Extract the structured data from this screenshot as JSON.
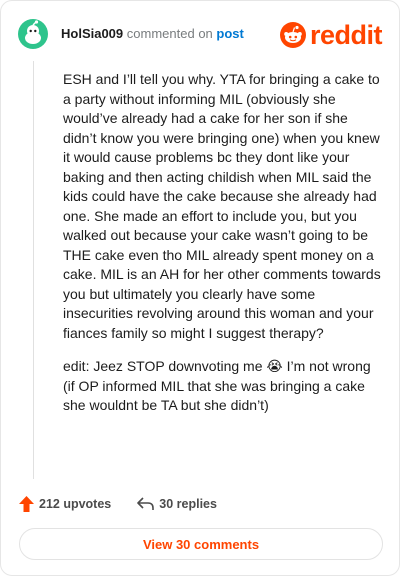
{
  "comment": {
    "username": "HolSia009",
    "action_text": "commented on",
    "post_link": "post",
    "paragraphs": [
      "ESH and I’ll tell you why. YTA for bringing a cake to a party without informing MIL (obviously she would’ve already had a cake for her son if she didn’t know you were bringing one) when you knew it would cause problems bc they dont like your baking and then acting childish when MIL said the kids could have the cake because she already had one. She made an effort to include you, but you walked out because your cake wasn’t going to be THE cake even tho MIL already spent money on a cake. MIL is an AH for her other comments towards you but ultimately you clearly have some insecurities revolving around this woman and your fiances family so might I suggest therapy?"
    ],
    "edit_before_emoji": "edit: Jeez STOP downvoting me",
    "edit_emoji": "😭",
    "edit_after_emoji": " I’m not wrong (if OP informed MIL that she was bringing a cake she wouldnt be TA but she didn’t)"
  },
  "logo": {
    "text": "reddit",
    "icon": "reddit-alien-icon"
  },
  "actions": {
    "upvotes": "212 upvotes",
    "replies": "30 replies",
    "upvote_icon": "upvote-arrow-icon",
    "reply_icon": "reply-arrow-icon"
  },
  "view_button": {
    "label": "View 30 comments"
  },
  "colors": {
    "brand": "#ff4500",
    "link": "#0079d3",
    "avatar": "#2ec48c"
  }
}
